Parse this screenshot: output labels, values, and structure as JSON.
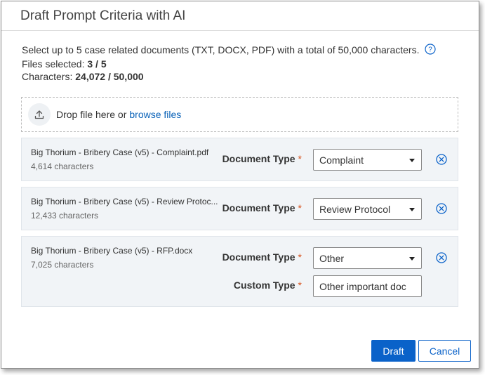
{
  "dialog": {
    "title": "Draft Prompt Criteria with AI"
  },
  "intro": {
    "description": "Select up to 5 case related documents (TXT, DOCX, PDF) with a total of 50,000 characters.",
    "files_label": "Files selected: ",
    "files_value": "3 / 5",
    "chars_label": "Characters: ",
    "chars_value": "24,072 / 50,000"
  },
  "drop": {
    "text": "Drop file here or",
    "browse_label": "browse files"
  },
  "labels": {
    "document_type": "Document Type",
    "custom_type": "Custom Type",
    "required": "*"
  },
  "files": [
    {
      "name": "Big Thorium - Bribery Case (v5) - Complaint.pdf",
      "chars": "4,614 characters",
      "doc_type": "Complaint"
    },
    {
      "name": "Big Thorium - Bribery Case (v5) - Review Protoc...",
      "chars": "12,433 characters",
      "doc_type": "Review Protocol"
    },
    {
      "name": "Big Thorium - Bribery Case (v5) - RFP.docx",
      "chars": "7,025 characters",
      "doc_type": "Other",
      "custom_type": "Other important doc"
    }
  ],
  "footer": {
    "draft_label": "Draft",
    "cancel_label": "Cancel"
  },
  "colors": {
    "accent": "#0a62c9",
    "required": "#d7531f",
    "card_bg": "#f1f4f7"
  }
}
